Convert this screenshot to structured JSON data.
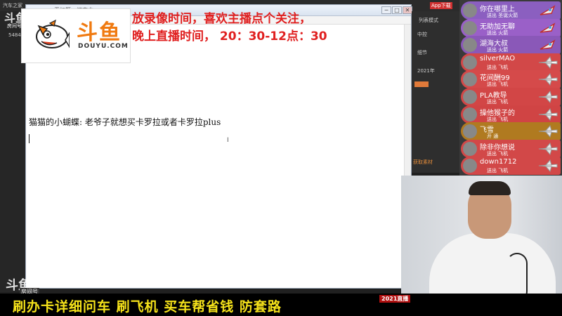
{
  "notepad": {
    "title": "无标题 - 记事本",
    "line": "猫猫的小蝴蝶:   老爷子就想买卡罗拉或者卡罗拉plus",
    "controls": [
      "─",
      "□",
      "✕"
    ]
  },
  "logo": {
    "cn": "斗鱼",
    "en": "DOUYU.COM"
  },
  "announce": {
    "line1": "放录像时间，喜欢主播点个关注，",
    "line2": "晚上直播时间， 20：30-12点：30"
  },
  "gifts": [
    {
      "name": "你在哪里上",
      "sub": "送出 圣诞火箭",
      "color": "#8b5fc0"
    },
    {
      "name": "无助加无聊",
      "sub": "送出 火箭",
      "color": "#9a60c8"
    },
    {
      "name": "湖海大叔",
      "sub": "送出 火箭",
      "color": "#8a58b8"
    },
    {
      "name": "silverMAO",
      "sub": "送出 飞机",
      "color": "#d24848"
    },
    {
      "name": "花间酬99",
      "sub": "送出 飞机",
      "color": "#d54a4a"
    },
    {
      "name": "PLA教导",
      "sub": "送出 飞机",
      "color": "#d24646"
    },
    {
      "name": "操他猴子的",
      "sub": "送出 飞机",
      "color": "#d04444"
    },
    {
      "name": "飞雪",
      "sub": "开 通",
      "color": "#b07a20"
    },
    {
      "name": "除非你想说",
      "sub": "送出 飞机",
      "color": "#d24848"
    },
    {
      "name": "down1712",
      "sub": "送出 飞机",
      "color": "#d24848"
    }
  ],
  "bgpanel": {
    "labels": [
      "列表模式",
      "中控",
      "细节",
      "2021年",
      "获取素材"
    ]
  },
  "corner": {
    "logo": "斗鱼",
    "sub": "房间号",
    "tl_logo": "斗鱼",
    "tl_sub": "房间号",
    "tl_num": "5484"
  },
  "banner": {
    "text": "刷办卡详细问车  刷飞机  买车帮省钱  防套路",
    "tag": "2021直播"
  },
  "desk": {
    "top_left": "汽车之家",
    "top_right": "App下载"
  },
  "colors": {
    "announce": "#e02020",
    "banner_text": "#f5e21a",
    "logo_orange": "#f07a10"
  }
}
